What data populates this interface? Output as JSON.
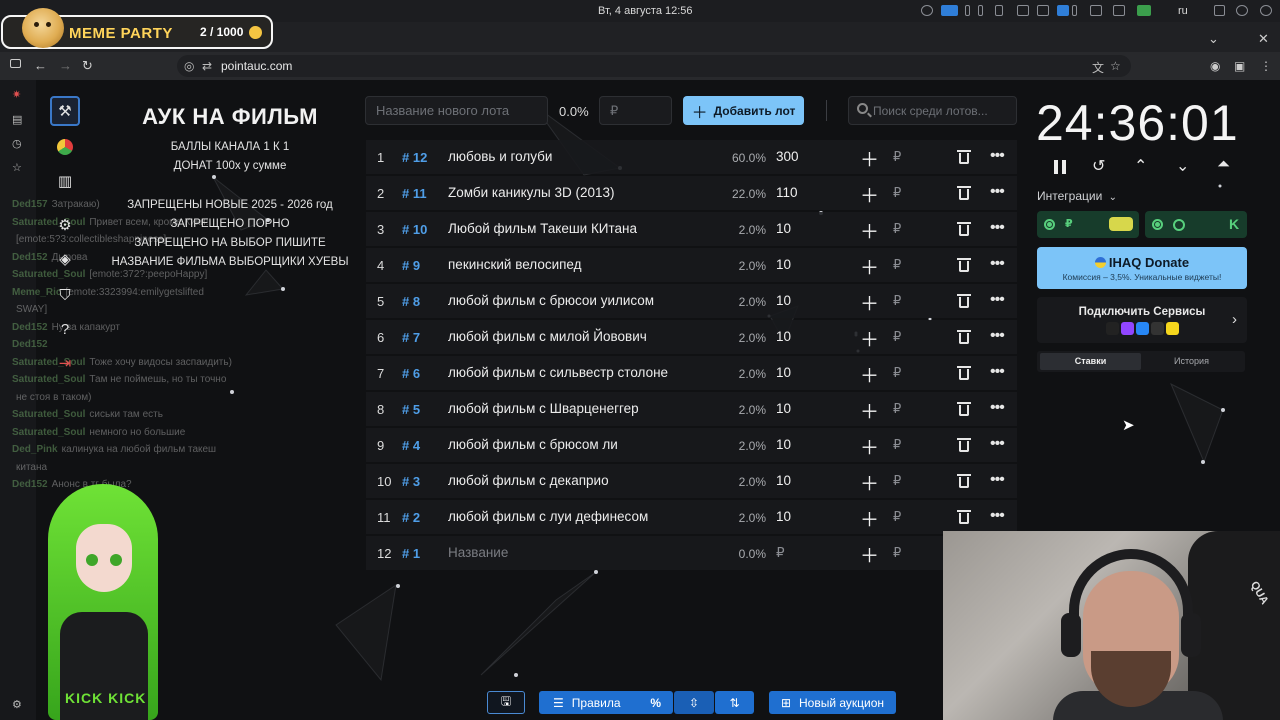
{
  "system": {
    "clock": "Вт, 4 августа  12:56",
    "lang": "ru"
  },
  "overlay": {
    "title": "MEME PARTY",
    "count": "2 / 1000"
  },
  "browser": {
    "url": "pointauc.com"
  },
  "auction": {
    "title": "АУК НА ФИЛЬМ",
    "lines_top": [
      "БАЛЛЫ КАНАЛА 1 К 1",
      "ДОНАТ 100х у сумме"
    ],
    "lines_bottom": [
      "ЗАПРЕЩЕНЫ НОВЫЕ 2025 - 2026 год",
      "ЗАПРЕЩЕНО ПОРНО",
      "ЗАПРЕЩЕНО НА ВЫБОР ПИШИТЕ",
      "НАЗВАНИЕ ФИЛЬМА ВЫБОРЩИКИ ХУЕВЫ"
    ]
  },
  "chat": [
    {
      "user": "Ded157",
      "text": "Затракаю)"
    },
    {
      "user": "Saturated_Soul",
      "text": "Привет всем, кроме Кики!"
    },
    {
      "user": "",
      "text": "[emote:5?3:collectibleshappiness]"
    },
    {
      "user": "Ded152",
      "text": "Дырова"
    },
    {
      "user": "Saturated_Soul",
      "text": "[emote:372?:peepoHappy]"
    },
    {
      "user": "Meme_Ric",
      "text": "[emote:3323994:emilygetslifted"
    },
    {
      "user": "",
      "text": "SWAY]"
    },
    {
      "user": "Ded152",
      "text": "Ну за капакурт"
    },
    {
      "user": "Ded152",
      "text": ""
    },
    {
      "user": "Saturated_Soul",
      "text": "Тоже хочу видосы заспаидить)"
    },
    {
      "user": "Saturated_Soul",
      "text": "Там не поймешь, но ты точно"
    },
    {
      "user": "",
      "text": "не стоя в таком)"
    },
    {
      "user": "Saturated_Soul",
      "text": "сиськи там есть"
    },
    {
      "user": "Saturated_Soul",
      "text": "немного но большие"
    },
    {
      "user": "Ded_Pink",
      "text": "калинука на любой фильм такеш"
    },
    {
      "user": "",
      "text": "китана"
    },
    {
      "user": "Ded152",
      "text": "Анонс в тг была?"
    }
  ],
  "controls": {
    "new_lot_placeholder": "Название нового лота",
    "percent": "0.0%",
    "amount_placeholder": "₽",
    "add_label": "Добавить лот",
    "search_placeholder": "Поиск среди лотов..."
  },
  "lots": [
    {
      "n": "1",
      "id": "# 12",
      "name": "любовь и голуби",
      "pct": "60.0%",
      "amount": "300"
    },
    {
      "n": "2",
      "id": "# 11",
      "name": "Zомби каникулы 3D (2013)",
      "pct": "22.0%",
      "amount": "110"
    },
    {
      "n": "3",
      "id": "# 10",
      "name": "Любой фильм Такеши КИтана",
      "pct": "2.0%",
      "amount": "10"
    },
    {
      "n": "4",
      "id": "# 9",
      "name": "пекинский велосипед",
      "pct": "2.0%",
      "amount": "10"
    },
    {
      "n": "5",
      "id": "# 8",
      "name": "любой фильм с брюсои уилисом",
      "pct": "2.0%",
      "amount": "10"
    },
    {
      "n": "6",
      "id": "# 7",
      "name": "любой фильм с милой Йовович",
      "pct": "2.0%",
      "amount": "10"
    },
    {
      "n": "7",
      "id": "# 6",
      "name": "любой фильм с сильвестр столоне",
      "pct": "2.0%",
      "amount": "10"
    },
    {
      "n": "8",
      "id": "# 5",
      "name": "любой фильм с Шварценеггер",
      "pct": "2.0%",
      "amount": "10"
    },
    {
      "n": "9",
      "id": "# 4",
      "name": "любой фильм с брюсом ли",
      "pct": "2.0%",
      "amount": "10"
    },
    {
      "n": "10",
      "id": "# 3",
      "name": "любой фильм с декаприо",
      "pct": "2.0%",
      "amount": "10"
    },
    {
      "n": "11",
      "id": "# 2",
      "name": "любой фильм с луи дефинесом",
      "pct": "2.0%",
      "amount": "10"
    }
  ],
  "empty_lot": {
    "n": "12",
    "id": "# 1",
    "name_placeholder": "Название",
    "pct": "0.0%",
    "amount_placeholder": "₽"
  },
  "rub": "₽",
  "timer": {
    "value": "24:36:01"
  },
  "integrations": {
    "label": "Интеграции",
    "donate_title": "IHAQ Donate",
    "donate_sub": "Комиссия – 3,5%. Уникальные виджеты!",
    "connect_title": "Подключить Сервисы",
    "tabs": [
      "Ставки",
      "История"
    ]
  },
  "bottom": {
    "rules_label": "Правила",
    "new_auction_label": "Новый аукцион"
  },
  "avatar": {
    "shirt_text": "KICK KICK"
  },
  "webcam": {
    "chair_text": "QUA"
  },
  "colors": {
    "accent": "#7cc4f8",
    "id": "#4f9ee8",
    "bottom_blue": "#1f6fd0",
    "integration_green": "#58d07d"
  }
}
